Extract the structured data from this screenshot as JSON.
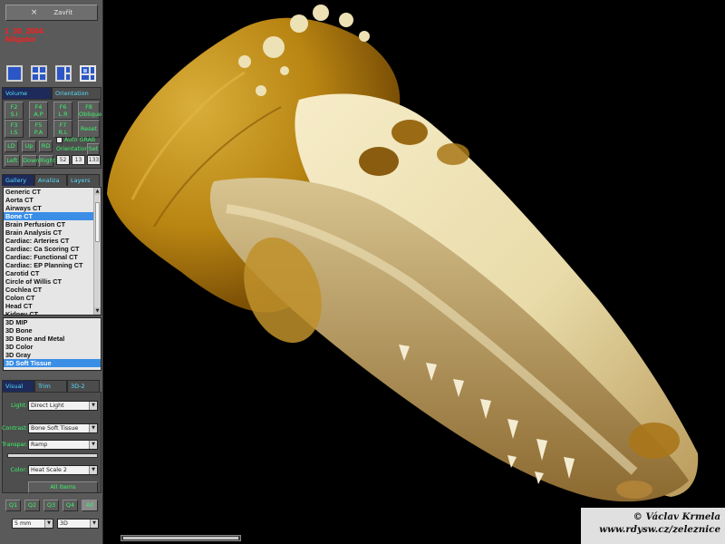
{
  "panel": {
    "close_label": "Zavřít",
    "close_icon": "×",
    "study_date": "1_30_2004",
    "study_name": "Alligator"
  },
  "upper_tabs": [
    "Volume",
    "Orientation"
  ],
  "fkeys": [
    {
      "key": "F2",
      "label": "S.I"
    },
    {
      "key": "F4",
      "label": "A.P"
    },
    {
      "key": "F6",
      "label": "L.R"
    },
    {
      "key": "F8",
      "label": "Oblique"
    },
    {
      "key": "F3",
      "label": "I.S"
    },
    {
      "key": "F5",
      "label": "P.A"
    },
    {
      "key": "F7",
      "label": "R.L"
    },
    {
      "key": "",
      "label": "Reset"
    }
  ],
  "nav_buttons": [
    "LD",
    "Up",
    "RD",
    "Left",
    "Down",
    "Right"
  ],
  "auto_grab_label": "Auto GRAB",
  "orientation_label": "Orientation:",
  "set_label": "Set",
  "orientation_values": [
    "52",
    "13",
    "133"
  ],
  "mid_tabs": [
    "Gallery",
    "Analiza",
    "Layers"
  ],
  "protocols": {
    "items": [
      "Generic CT",
      "Aorta CT",
      "Airways CT",
      "Bone CT",
      "Brain Perfusion CT",
      "Brain Analysis CT",
      "Cardiac: Arteries CT",
      "Cardiac: Ca Scoring CT",
      "Cardiac: Functional CT",
      "Cardiac: EP Planning CT",
      "Carotid CT",
      "Circle of Willis CT",
      "Cochlea CT",
      "Colon CT",
      "Head CT",
      "Kidney CT"
    ],
    "selected": "Bone CT"
  },
  "presets": {
    "items": [
      "3D MIP",
      "3D Bone",
      "3D Bone and Metal",
      "3D Color",
      "3D Gray",
      "3D Soft Tissue"
    ],
    "selected": "3D Soft Tissue"
  },
  "lower_tabs": [
    "Visual",
    "Trim",
    "3D-2"
  ],
  "visual": {
    "light_label": "Light:",
    "light_value": "Direct Light",
    "contrast_label": "Contrast:",
    "contrast_value": "Bone Soft Tissue",
    "transpar_label": "Transpar.",
    "transpar_value": "Ramp",
    "color_label": "Color:",
    "color_value": "Heat Scale 2",
    "all_items_label": "All Items"
  },
  "quadrants": [
    "Q1",
    "Q2",
    "Q3",
    "Q4",
    "All"
  ],
  "thickness_value": "5 mm",
  "mode_value": "3D",
  "colors": {
    "study_text": "#ff1d1d",
    "button_text": "#3cf26a",
    "tab_text": "#56dcff",
    "selection": "#3a8ee6",
    "layout_blue": "#2b56c6",
    "bone": "#efe2b4",
    "flesh": "#b88412"
  },
  "credit": {
    "line1": "© Václav Krmela",
    "line2": "www.rdysw.cz/zeleznice"
  }
}
